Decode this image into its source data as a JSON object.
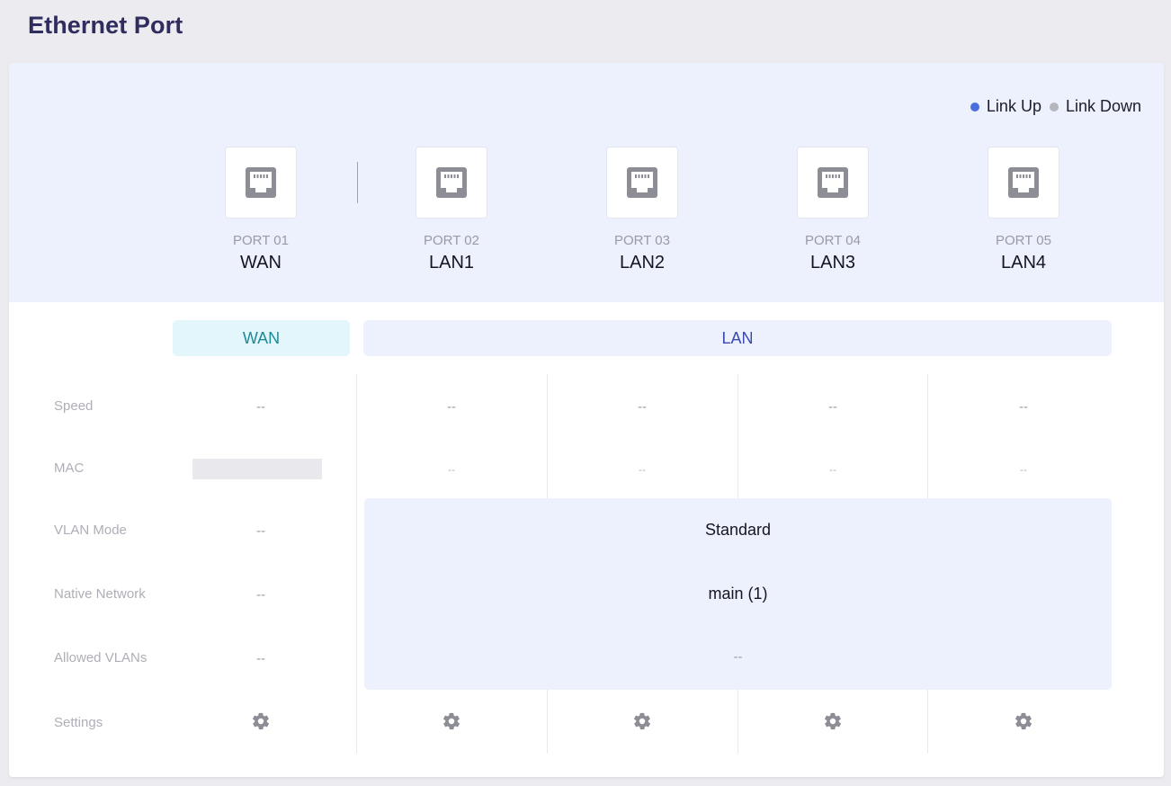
{
  "page": {
    "title": "Ethernet Port"
  },
  "legend": {
    "link_up": {
      "label": "Link Up",
      "color": "#4a6ee0"
    },
    "link_down": {
      "label": "Link Down",
      "color": "#b5b5bd"
    }
  },
  "ports": [
    {
      "number": "PORT 01",
      "name": "WAN",
      "icon": "ethernet-port-icon"
    },
    {
      "number": "PORT 02",
      "name": "LAN1",
      "icon": "ethernet-port-icon"
    },
    {
      "number": "PORT 03",
      "name": "LAN2",
      "icon": "ethernet-port-icon"
    },
    {
      "number": "PORT 04",
      "name": "LAN3",
      "icon": "ethernet-port-icon"
    },
    {
      "number": "PORT 05",
      "name": "LAN4",
      "icon": "ethernet-port-icon"
    }
  ],
  "groups": {
    "wan": "WAN",
    "lan": "LAN"
  },
  "rows": {
    "speed": "Speed",
    "mac": "MAC",
    "vlan_mode": "VLAN Mode",
    "native_network": "Native Network",
    "allowed_vlans": "Allowed VLANs",
    "settings": "Settings"
  },
  "wan": {
    "speed": "--",
    "vlan_mode": "--",
    "native_network": "--",
    "allowed_vlans": "--"
  },
  "lan_ports": [
    {
      "speed": "--",
      "mac": "--"
    },
    {
      "speed": "--",
      "mac": "--"
    },
    {
      "speed": "--",
      "mac": "--"
    },
    {
      "speed": "--",
      "mac": "--"
    }
  ],
  "lan_shared": {
    "vlan_mode": "Standard",
    "native_network": "main (1)",
    "allowed_vlans": "--"
  },
  "settings_icon": "gear-icon"
}
